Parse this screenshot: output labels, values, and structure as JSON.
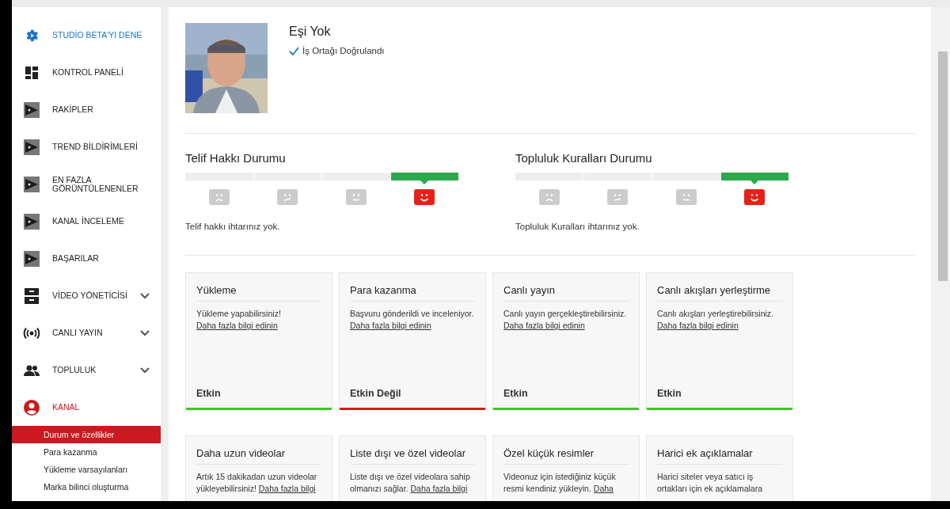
{
  "sidebar": {
    "items": [
      {
        "kind": "studio",
        "label": "STUDİO BETA'YI DENE",
        "expandable": false,
        "selected": false
      },
      {
        "kind": "dashboard",
        "label": "KONTROL PANELİ",
        "expandable": false,
        "selected": false
      },
      {
        "kind": "iq",
        "label": "RAKİPLER",
        "expandable": false,
        "selected": false
      },
      {
        "kind": "iq",
        "label": "TREND BİLDİRİMLERİ",
        "expandable": false,
        "selected": false
      },
      {
        "kind": "iq",
        "label": "EN FAZLA GÖRÜNTÜLENENLER",
        "expandable": false,
        "selected": false
      },
      {
        "kind": "iq",
        "label": "KANAL İNCELEME",
        "expandable": false,
        "selected": false
      },
      {
        "kind": "iq",
        "label": "BAŞARILAR",
        "expandable": false,
        "selected": false
      },
      {
        "kind": "videos",
        "label": "VİDEO YÖNETİCİSİ",
        "expandable": true,
        "selected": false
      },
      {
        "kind": "live",
        "label": "CANLI YAYIN",
        "expandable": true,
        "selected": false
      },
      {
        "kind": "community",
        "label": "TOPLULUK",
        "expandable": true,
        "selected": false
      },
      {
        "kind": "channel",
        "label": "KANAL",
        "expandable": false,
        "selected": true,
        "children": [
          {
            "label": "Durum ve özellikler",
            "selected": true
          },
          {
            "label": "Para kazanma",
            "selected": false
          },
          {
            "label": "Yükleme varsayılanları",
            "selected": false
          },
          {
            "label": "Marka bilinci oluşturma",
            "selected": false
          }
        ]
      }
    ]
  },
  "profile": {
    "name": "Eşi Yok",
    "verified": true,
    "verified_label": "İş Ortağı Doğrulandı"
  },
  "statuses": [
    {
      "title": "Telif Hakkı Durumu",
      "segments": [
        {
          "kind": "sad",
          "selected": false
        },
        {
          "kind": "uneasy",
          "selected": false
        },
        {
          "kind": "neutral",
          "selected": false
        },
        {
          "kind": "happy",
          "selected": true
        }
      ],
      "message": "Telif hakkı ihtarınız yok."
    },
    {
      "title": "Topluluk Kuralları Durumu",
      "segments": [
        {
          "kind": "sad",
          "selected": false
        },
        {
          "kind": "uneasy",
          "selected": false
        },
        {
          "kind": "neutral",
          "selected": false
        },
        {
          "kind": "happy",
          "selected": true
        }
      ],
      "message": "Topluluk Kuralları ihtarınız yok."
    }
  ],
  "cards": [
    {
      "title": "Yükleme",
      "text": "Yükleme yapabilirsiniz!",
      "link": "Daha fazla bilgi edinin",
      "status": "Etkin",
      "active": true
    },
    {
      "title": "Para kazanma",
      "text": "Başvuru gönderildi ve inceleniyor.",
      "link": "Daha fazla bilgi edinin",
      "status": "Etkin Değil",
      "active": false
    },
    {
      "title": "Canlı yayın",
      "text": "Canlı yayın gerçekleştirebilirsiniz.",
      "link": "Daha fazla bilgi edinin",
      "status": "Etkin",
      "active": true
    },
    {
      "title": "Canlı akışları yerleştirme",
      "text": "Canlı akışları yerleştirebilirsiniz.",
      "link": "Daha fazla bilgi edinin",
      "status": "Etkin",
      "active": true
    },
    {
      "title": "Daha uzun videolar",
      "text": "Artık 15 dakikadan uzun videolar yükleyebilirsiniz!",
      "link": "Daha fazla bilgi"
    },
    {
      "title": "Liste dışı ve özel videolar",
      "text": "Liste dışı ve özel videolara sahip olmanızı sağlar.",
      "link": "Daha fazla bilgi"
    },
    {
      "title": "Özel küçük resimler",
      "text": "Videonuz için istediğiniz küçük resmi kendiniz yükleyin.",
      "link": "Daha"
    },
    {
      "title": "Harici ek açıklamalar",
      "text": "Harici siteler veya satıcı iş ortakları için ek açıklamalara"
    }
  ]
}
